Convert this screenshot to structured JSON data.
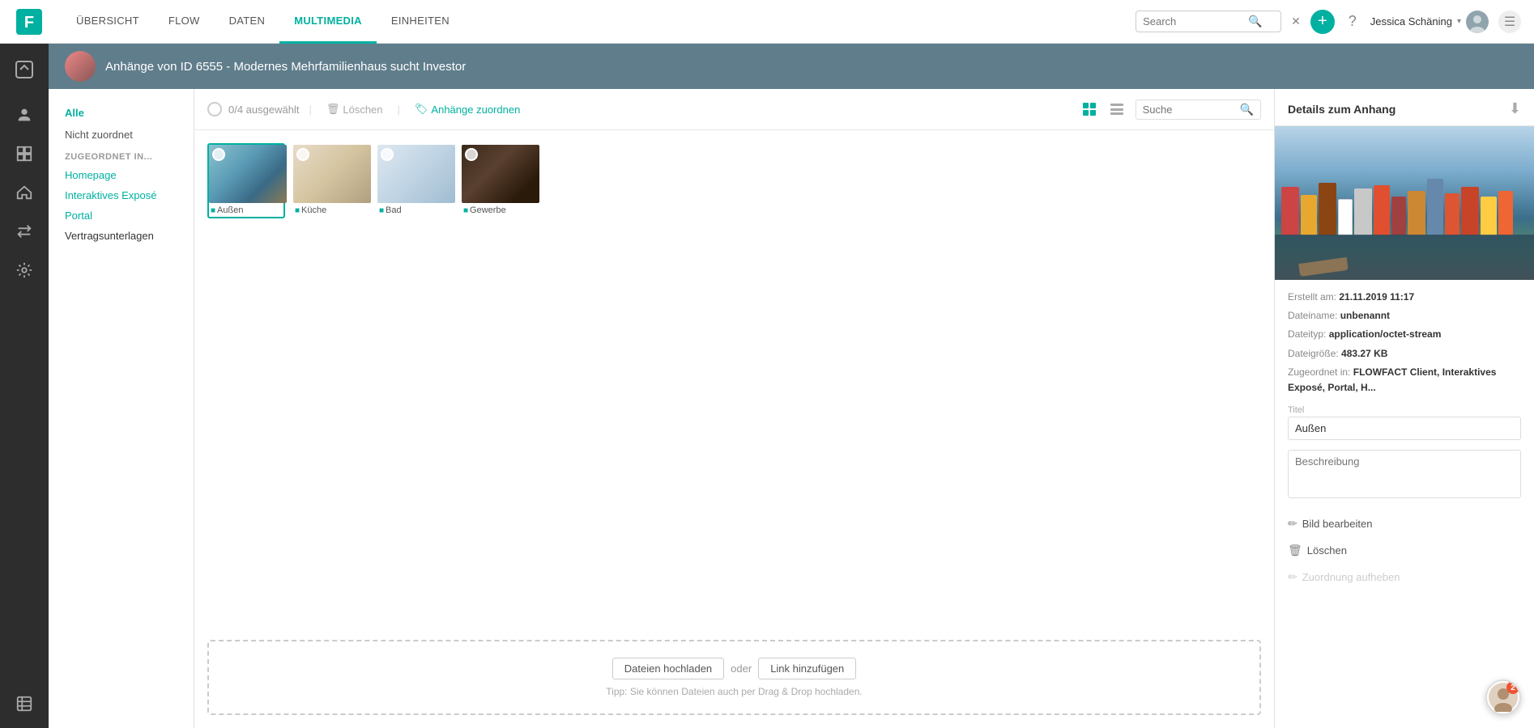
{
  "topNav": {
    "links": [
      {
        "id": "ubersicht",
        "label": "ÜBERSICHT",
        "active": false
      },
      {
        "id": "flow",
        "label": "FLOW",
        "active": false
      },
      {
        "id": "daten",
        "label": "DATEN",
        "active": false
      },
      {
        "id": "multimedia",
        "label": "MULTIMEDIA",
        "active": true
      },
      {
        "id": "einheiten",
        "label": "EINHEITEN",
        "active": false
      }
    ],
    "searchPlaceholder": "Search",
    "userName": "Jessica Schäning",
    "addBtnLabel": "+",
    "helpLabel": "?"
  },
  "iconSidebar": {
    "items": [
      {
        "id": "logo",
        "icon": "◈",
        "label": "logo"
      },
      {
        "id": "person",
        "icon": "👤",
        "label": "person-icon"
      },
      {
        "id": "grid",
        "icon": "⊞",
        "label": "grid-icon"
      },
      {
        "id": "home",
        "icon": "⌂",
        "label": "home-icon"
      },
      {
        "id": "swap",
        "icon": "⇄",
        "label": "swap-icon"
      },
      {
        "id": "gear",
        "icon": "⚙",
        "label": "gear-icon"
      },
      {
        "id": "table",
        "icon": "⊟",
        "label": "table-icon"
      }
    ]
  },
  "header": {
    "title": "Anhänge von ID 6555 - Modernes Mehrfamilienhaus sucht Investor"
  },
  "leftPanel": {
    "allLabel": "Alle",
    "notAssignedLabel": "Nicht zuordnet",
    "sectionLabel": "ZUGEORDNET IN...",
    "subItems": [
      {
        "id": "homepage",
        "label": "Homepage"
      },
      {
        "id": "interaktives",
        "label": "Interaktives Exposé"
      },
      {
        "id": "portal",
        "label": "Portal"
      },
      {
        "id": "vertragsunterlagen",
        "label": "Vertragsunterlagen"
      }
    ]
  },
  "toolbar": {
    "selectedCount": "0/4 ausgewählt",
    "deleteLabel": "Löschen",
    "assignLabel": "Anhänge zuordnen",
    "searchPlaceholder": "Suche"
  },
  "images": [
    {
      "id": "aussen",
      "label": "Außen",
      "thumb": "aussen",
      "selected": true
    },
    {
      "id": "kuche",
      "label": "Küche",
      "thumb": "kuche",
      "selected": false
    },
    {
      "id": "bad",
      "label": "Bad",
      "thumb": "bad",
      "selected": false
    },
    {
      "id": "gewerbe",
      "label": "Gewerbe",
      "thumb": "gewerbe",
      "selected": false
    }
  ],
  "uploadZone": {
    "uploadBtnLabel": "Dateien hochladen",
    "orLabel": "oder",
    "linkBtnLabel": "Link hinzufügen",
    "tipText": "Tipp: Sie können Dateien auch per Drag & Drop hochladen."
  },
  "rightPanel": {
    "title": "Details zum Anhang",
    "details": {
      "createdLabel": "Erstellt am:",
      "createdValue": "21.11.2019 11:17",
      "filenameLabel": "Dateiname:",
      "filenameValue": "unbenannt",
      "filetypeLabel": "Dateityp:",
      "filetypeValue": "application/octet-stream",
      "filesizeLabel": "Dateigröße:",
      "filesizeValue": "483.27 KB",
      "assignedLabel": "Zugeordnet in:",
      "assignedValue": "FLOWFACT Client, Interaktives Exposé, Portal, H..."
    },
    "titleFieldLabel": "Titel",
    "titleFieldValue": "Außen",
    "descriptionPlaceholder": "Beschreibung",
    "actions": [
      {
        "id": "edit",
        "icon": "✏",
        "label": "Bild bearbeiten",
        "disabled": false
      },
      {
        "id": "delete",
        "icon": "🗑",
        "label": "Löschen",
        "disabled": false
      },
      {
        "id": "unassign",
        "icon": "✏",
        "label": "Zuordnung aufheben",
        "disabled": true
      }
    ]
  },
  "chatBubble": {
    "badge": "2"
  }
}
